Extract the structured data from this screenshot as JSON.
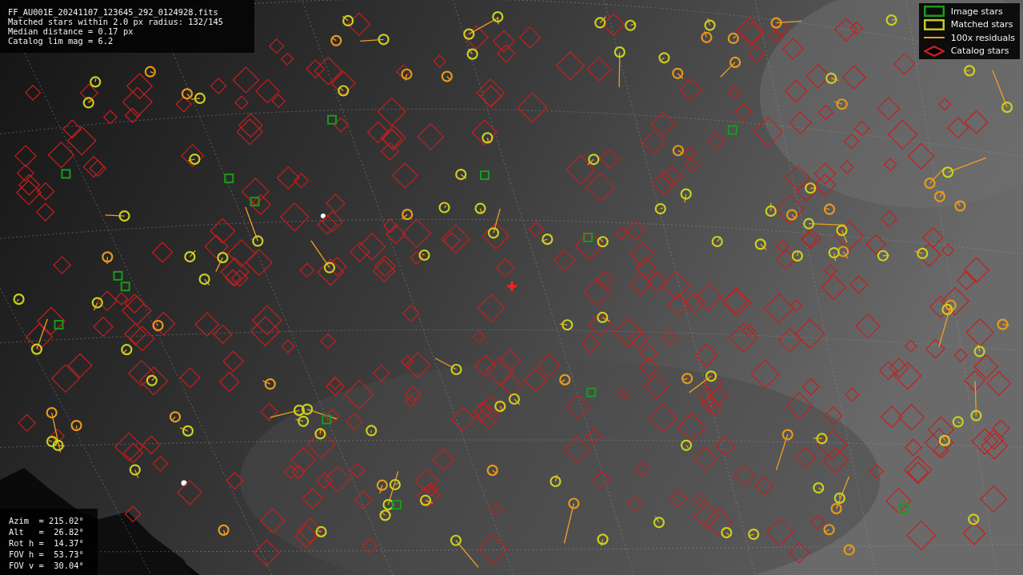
{
  "info": [
    "FF_AU001E_20241107_123645_292_0124928.fits",
    "Matched stars within 2.0 px radius: 132/145",
    "Median distance = 0.17 px",
    "Catalog lim mag = 6.2"
  ],
  "legend": [
    {
      "kind": "box",
      "label": "Image stars",
      "color": "#1a9a1a"
    },
    {
      "kind": "box",
      "label": "Matched stars",
      "color": "#c8c81e"
    },
    {
      "kind": "line",
      "label": "100x residuals",
      "color": "#f0a020"
    },
    {
      "kind": "diamond",
      "label": "Catalog stars",
      "color": "#c81e1e"
    }
  ],
  "pointing": [
    "Azim  = 215.02°",
    "Alt   =  26.82°",
    "Rot h =  14.37°",
    "FOV h =  53.73°",
    "FOV v =  30.04°"
  ]
}
